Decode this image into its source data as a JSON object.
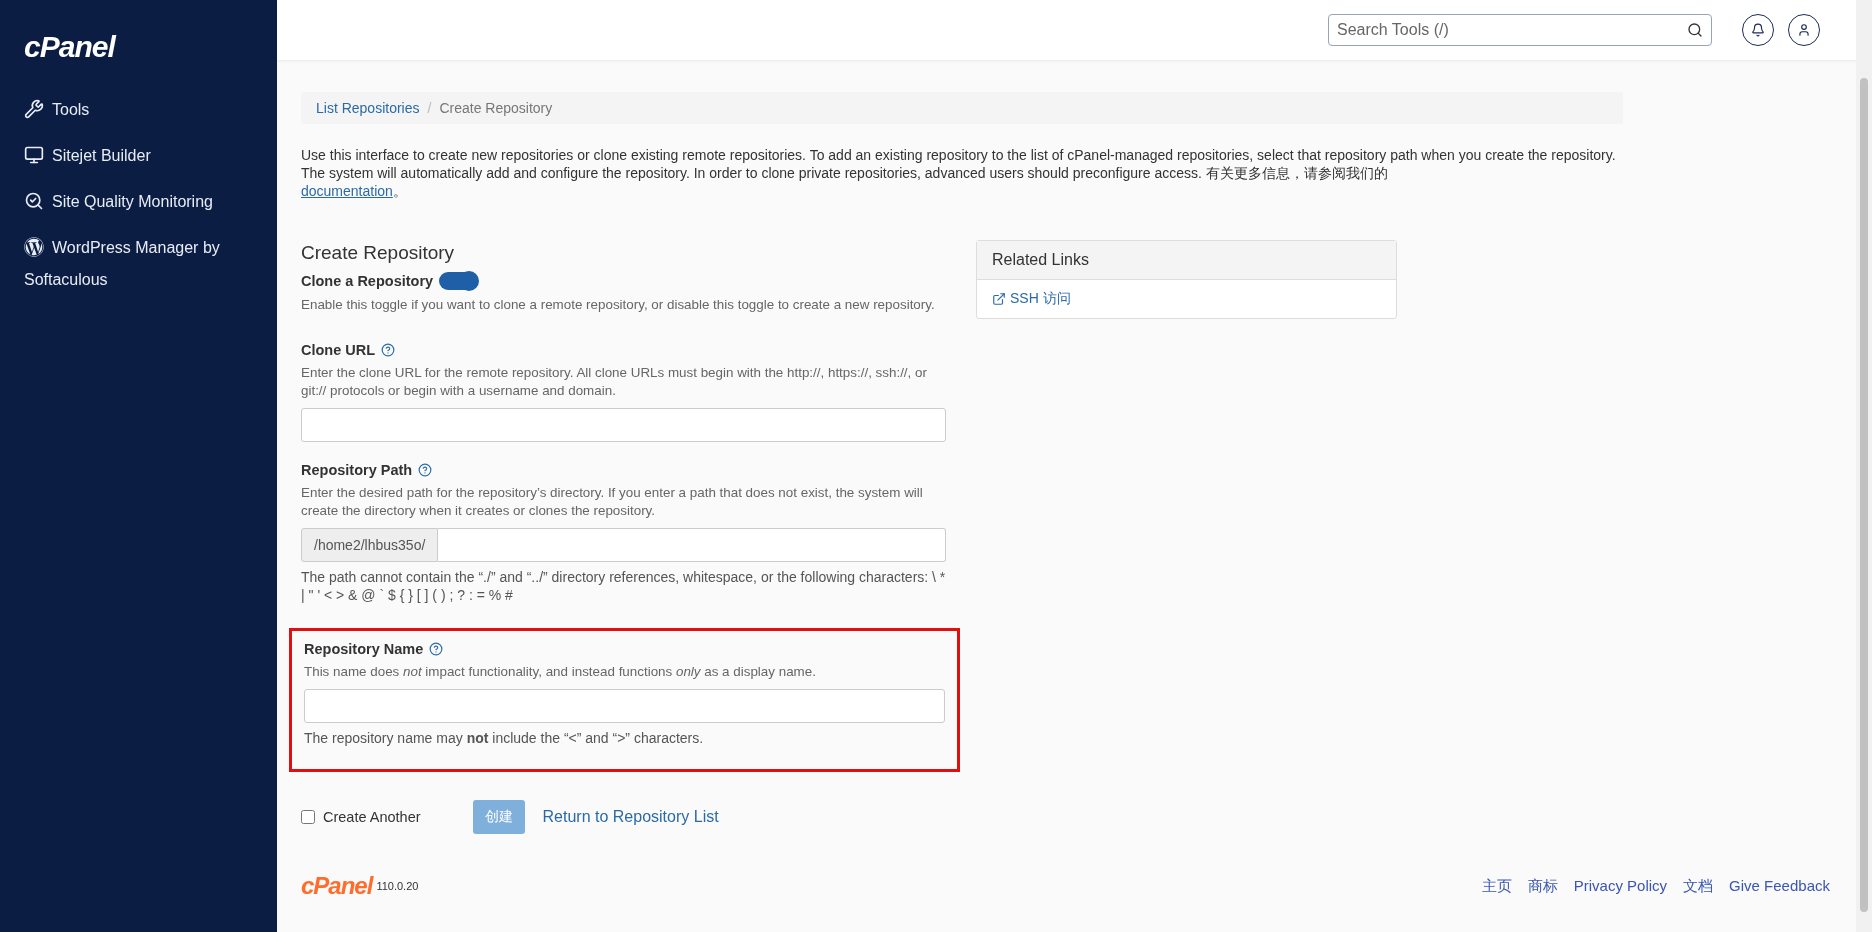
{
  "sidebar": {
    "logo": "cPanel",
    "items": [
      {
        "kind": "tools",
        "label": "Tools"
      },
      {
        "kind": "builder",
        "label": "Sitejet Builder"
      },
      {
        "kind": "quality",
        "label": "Site Quality Monitoring"
      },
      {
        "kind": "wordpress",
        "label": "WordPress Manager by Softaculous"
      }
    ]
  },
  "topbar": {
    "search": {
      "placeholder": "Search Tools (/)"
    }
  },
  "breadcrumb_separator": "/",
  "breadcrumb": [
    {
      "label": "List Repositories",
      "selected": false
    },
    {
      "label": "Create Repository",
      "selected": true
    }
  ],
  "intro": {
    "text": "Use this interface to create new repositories or clone existing remote repositories. To add an existing repository to the list of cPanel-managed repositories, select that repository path when you create the repository. The system will automatically add and configure the repository. In order to clone private repositories, advanced users should preconfigure access. 有关更多信息，请参阅我们的",
    "link": "documentation",
    "after": "。"
  },
  "form": {
    "title": "Create Repository",
    "toggle": {
      "label": "Clone a Repository",
      "on": true,
      "description": "Enable this toggle if you want to clone a remote repository, or disable this toggle to create a new repository."
    },
    "fields": [
      {
        "kind": "text",
        "label": "Clone URL",
        "help": true,
        "highlighted": false,
        "description": "Enter the clone URL for the remote repository. All clone URLs must begin with the http://, https://, ssh://, or git:// protocols or begin with a username and domain."
      },
      {
        "kind": "prefixed",
        "label": "Repository Path",
        "help": true,
        "highlighted": false,
        "description": "Enter the desired path for the repository’s directory. If you enter a path that does not exist, the system will create the directory when it creates or clones the repository.",
        "prefix": "/home2/lhbus35o/",
        "note": "The path cannot contain the “./” and “../” directory references, whitespace, or the following characters: \\ * | \" ' < > & @ ` $ { } [ ] ( ) ; ? : = % #"
      },
      {
        "kind": "text",
        "label": "Repository Name",
        "help": true,
        "highlighted": true,
        "description": "This name does *not* impact functionality, and instead functions *only* as a display name.",
        "note": "The repository name may **not** include the “<” and “>” characters."
      }
    ],
    "create_another": {
      "label": "Create Another",
      "checked": false
    },
    "submit": {
      "label": "创建",
      "disabled": true
    },
    "return_link": "Return to Repository List"
  },
  "related_links": {
    "title": "Related Links",
    "links": [
      "SSH 访问"
    ]
  },
  "footer": {
    "logo": "cPanel",
    "version": "110.0.20",
    "links": [
      "主页",
      "商标",
      "Privacy Policy",
      "文档",
      "Give Feedback"
    ]
  }
}
